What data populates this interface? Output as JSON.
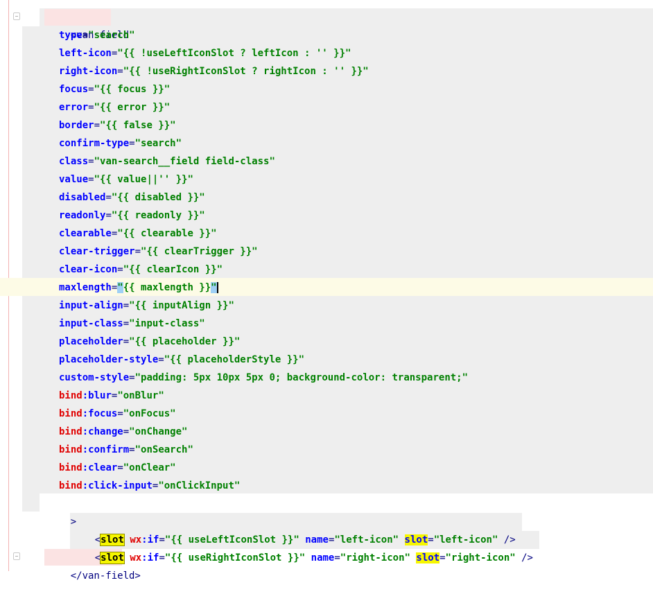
{
  "editor": {
    "open_tag": "<van-field",
    "attrs": [
      {
        "name": "type",
        "value": "\"search\""
      },
      {
        "name": "left-icon",
        "value": "\"{{ !useLeftIconSlot ? leftIcon : '' }}\""
      },
      {
        "name": "right-icon",
        "value": "\"{{ !useRightIconSlot ? rightIcon : '' }}\""
      },
      {
        "name": "focus",
        "value": "\"{{ focus }}\""
      },
      {
        "name": "error",
        "value": "\"{{ error }}\""
      },
      {
        "name": "border",
        "value": "\"{{ false }}\""
      },
      {
        "name": "confirm-type",
        "value": "\"search\""
      },
      {
        "name": "class",
        "value": "\"van-search__field field-class\""
      },
      {
        "name": "value",
        "value": "\"{{ value||'' }}\""
      },
      {
        "name": "disabled",
        "value": "\"{{ disabled }}\""
      },
      {
        "name": "readonly",
        "value": "\"{{ readonly }}\""
      },
      {
        "name": "clearable",
        "value": "\"{{ clearable }}\""
      },
      {
        "name": "clear-trigger",
        "value": "\"{{ clearTrigger }}\""
      },
      {
        "name": "clear-icon",
        "value": "\"{{ clearIcon }}\""
      },
      {
        "name": "maxlength",
        "value_open": "\"",
        "value_body": "{{ maxlength }}",
        "value_close": "\""
      },
      {
        "name": "input-align",
        "value": "\"{{ inputAlign }}\""
      },
      {
        "name": "input-class",
        "value": "\"input-class\""
      },
      {
        "name": "placeholder",
        "value": "\"{{ placeholder }}\""
      },
      {
        "name": "placeholder-style",
        "value": "\"{{ placeholderStyle }}\""
      },
      {
        "name": "custom-style",
        "value": "\"padding: 5px 10px 5px 0; background-color: transparent;\""
      }
    ],
    "bind_attrs": [
      {
        "ns": "bind",
        "event": "blur",
        "value": "\"onBlur\""
      },
      {
        "ns": "bind",
        "event": "focus",
        "value": "\"onFocus\""
      },
      {
        "ns": "bind",
        "event": "change",
        "value": "\"onChange\""
      },
      {
        "ns": "bind",
        "event": "confirm",
        "value": "\"onSearch\""
      },
      {
        "ns": "bind",
        "event": "clear",
        "value": "\"onClear\""
      },
      {
        "ns": "bind",
        "event": "click-input",
        "value": "\"onClickInput\""
      }
    ],
    "close_bracket": ">",
    "slots": [
      {
        "lt": "<",
        "tag": "slot",
        "wx": "wx",
        "if_attr": ":if",
        "if_value": "\"{{ useLeftIconSlot }}\"",
        "name_attr": "name",
        "name_value": "\"left-icon\"",
        "slot_attr": "slot",
        "slot_value": "\"left-icon\"",
        "end": " />"
      },
      {
        "lt": "<",
        "tag": "slot",
        "wx": "wx",
        "if_attr": ":if",
        "if_value": "\"{{ useRightIconSlot }}\"",
        "name_attr": "name",
        "name_value": "\"right-icon\"",
        "slot_attr": "slot",
        "slot_value": "\"right-icon\"",
        "end": " />"
      }
    ],
    "close_tag": "</van-field>"
  },
  "colors": {
    "tag": "#000080",
    "attribute": "#0000ff",
    "value": "#008000",
    "namespace": "#e00000",
    "highlight": "#f6f600",
    "caret_row": "#fdfbe6"
  },
  "icons": {
    "fold_top": "fold-marker-icon",
    "fold_bottom": "fold-marker-icon",
    "intention": "lightbulb-icon"
  }
}
